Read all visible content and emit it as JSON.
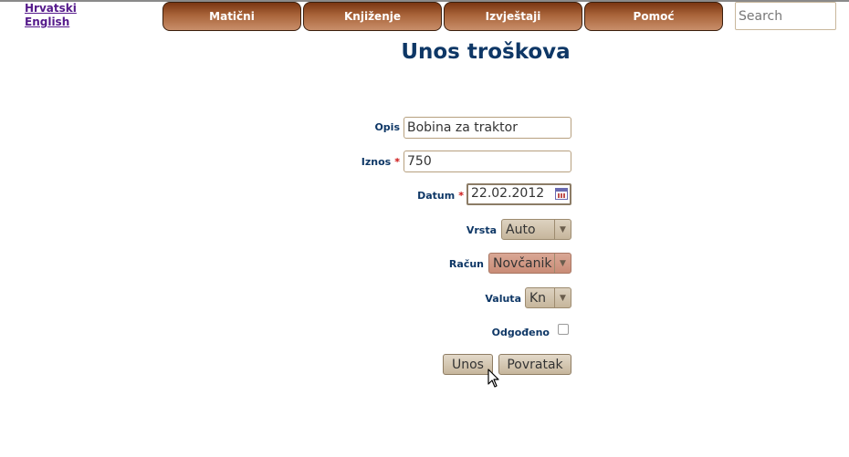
{
  "languages": [
    "Hrvatski",
    "English"
  ],
  "nav": [
    {
      "label": "Matični"
    },
    {
      "label": "Knjiženje"
    },
    {
      "label": "Izvještaji"
    },
    {
      "label": "Pomoć"
    }
  ],
  "search": {
    "placeholder": "Search"
  },
  "page_title": "Unos troškova",
  "form": {
    "opis": {
      "label": "Opis",
      "value": "Bobina za traktor"
    },
    "iznos": {
      "label": "Iznos",
      "required": "*",
      "value": "750"
    },
    "datum": {
      "label": "Datum",
      "required": "*",
      "value": "22.02.2012"
    },
    "vrsta": {
      "label": "Vrsta",
      "value": "Auto"
    },
    "racun": {
      "label": "Račun",
      "value": "Novčanik"
    },
    "valuta": {
      "label": "Valuta",
      "value": "Kn"
    },
    "odgodeno": {
      "label": "Odgođeno",
      "checked": false
    },
    "submit_label": "Unos",
    "back_label": "Povratak"
  }
}
